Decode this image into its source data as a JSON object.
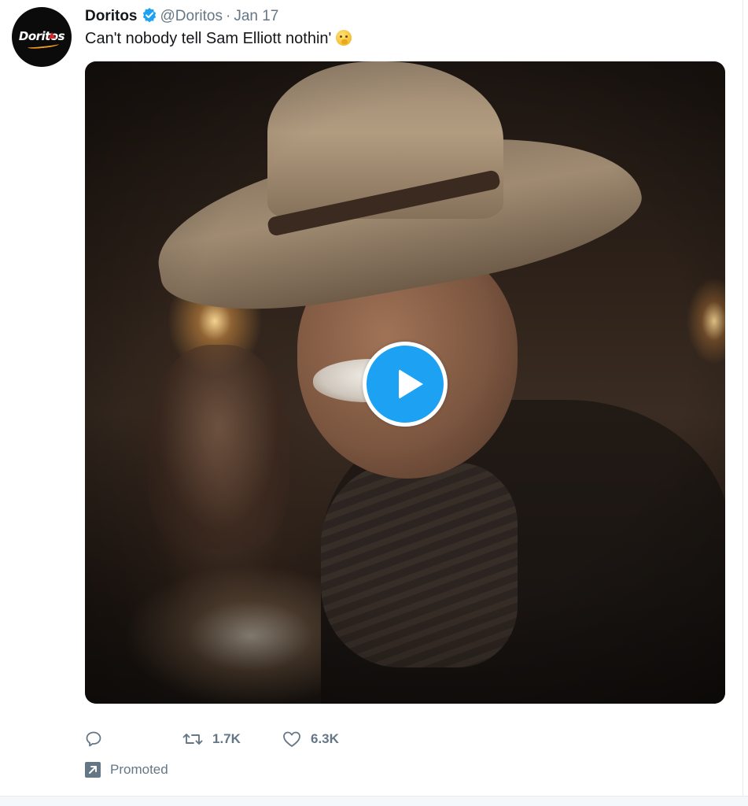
{
  "tweet": {
    "author_name": "Doritos",
    "handle": "@Doritos",
    "separator": "·",
    "date": "Jan 17",
    "text": "Can't nobody tell Sam Elliott nothin'",
    "emoji_icon": "shushing-face-icon",
    "avatar_logo_text": "Doritos",
    "verified_icon": "verified-badge-icon"
  },
  "media": {
    "type": "video",
    "play_icon": "play-icon"
  },
  "actions": {
    "reply_icon": "reply-icon",
    "reply_count": "",
    "retweet_icon": "retweet-icon",
    "retweet_count": "1.7K",
    "like_icon": "heart-icon",
    "like_count": "6.3K"
  },
  "promoted": {
    "label": "Promoted",
    "icon": "promoted-arrow-icon"
  },
  "colors": {
    "accent": "#1da1f2",
    "text": "#14171a",
    "secondary_text": "#657786",
    "border": "#e6ecf0"
  }
}
